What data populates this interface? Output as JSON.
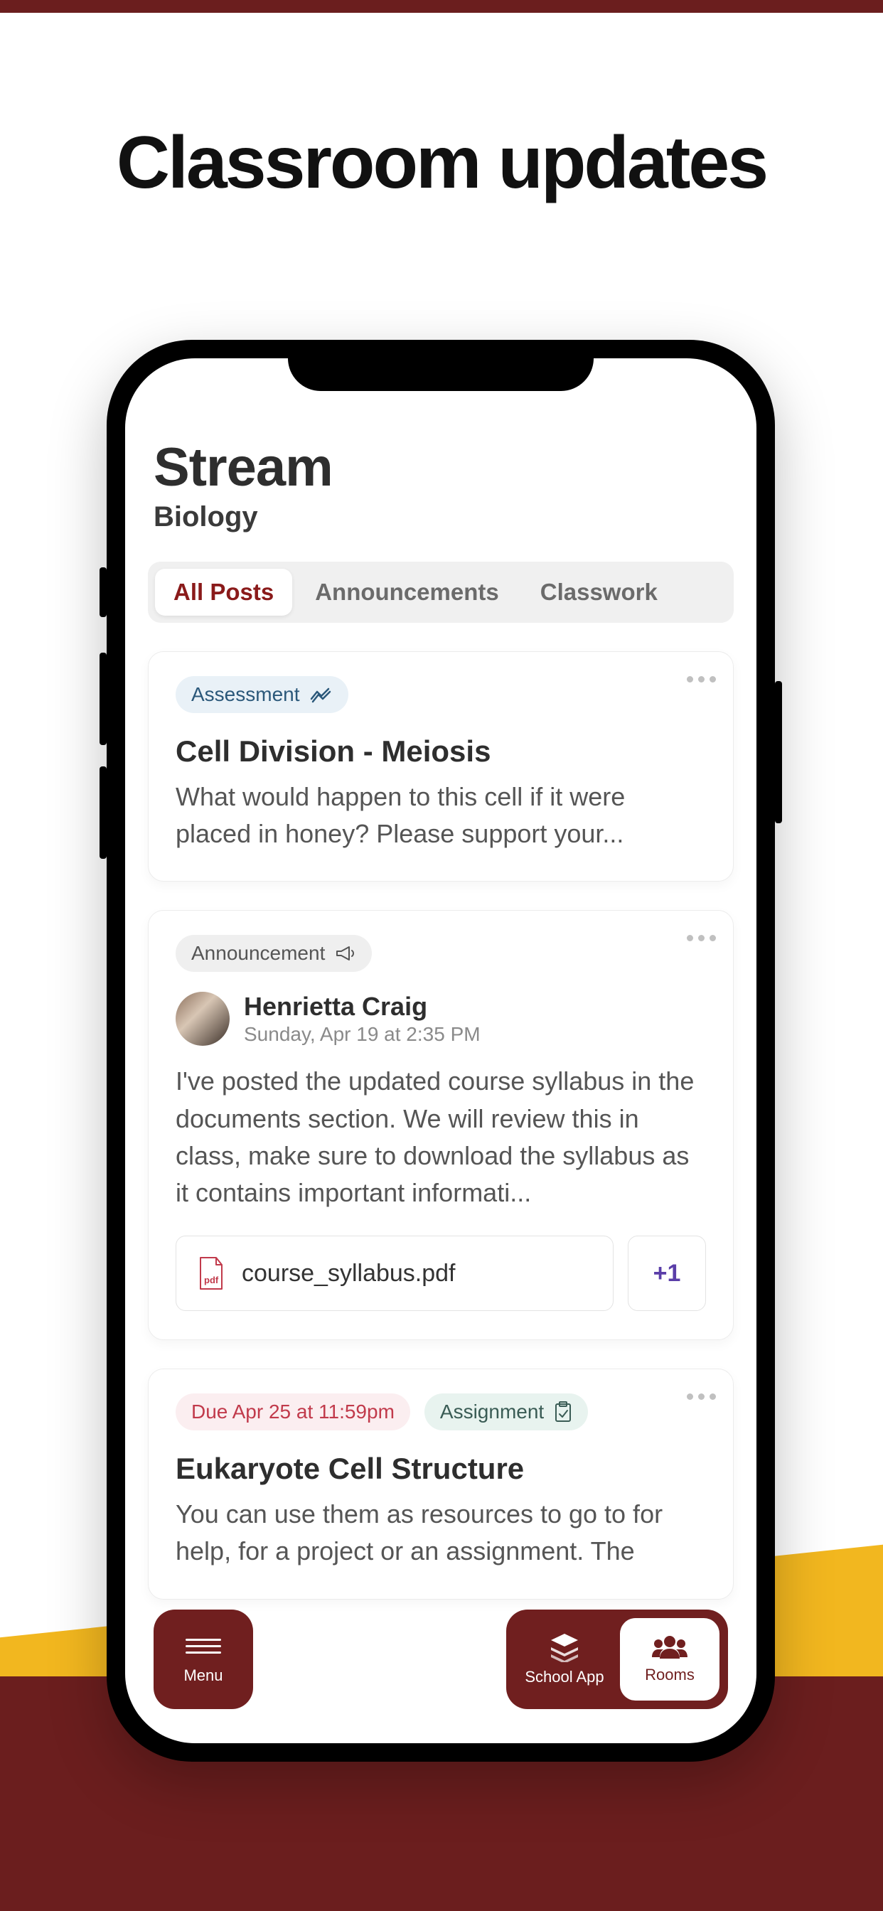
{
  "marketing": {
    "headline": "Classroom updates"
  },
  "header": {
    "title": "Stream",
    "subject": "Biology"
  },
  "tabs": [
    {
      "label": "All Posts",
      "active": true
    },
    {
      "label": "Announcements",
      "active": false
    },
    {
      "label": "Classwork",
      "active": false
    }
  ],
  "posts": [
    {
      "tag": {
        "label": "Assessment",
        "style": "blue",
        "icon": "chart-line-icon"
      },
      "title": "Cell Division - Meiosis",
      "body": "What would happen to this cell if it were placed in honey? Please support your..."
    },
    {
      "tag": {
        "label": "Announcement",
        "style": "grey",
        "icon": "megaphone-icon"
      },
      "author": {
        "name": "Henrietta Craig",
        "time": "Sunday, Apr 19 at 2:35 PM"
      },
      "body": "I've posted the updated course syllabus in the documents section. We will review this in class, make sure to download the syllabus as it contains important informati...",
      "attachment": {
        "filename": "course_syllabus.pdf",
        "icon": "pdf-icon"
      },
      "more_label": "+1"
    },
    {
      "due": {
        "label": "Due Apr 25 at 11:59pm"
      },
      "tag": {
        "label": "Assignment",
        "style": "green",
        "icon": "clipboard-check-icon"
      },
      "title": "Eukaryote Cell Structure",
      "body": "You can use them as resources to go to for help, for a project or an assignment. The"
    }
  ],
  "bottom": {
    "menu": {
      "label": "Menu"
    },
    "switcher": [
      {
        "label": "School App",
        "icon": "stack-icon",
        "active": false
      },
      {
        "label": "Rooms",
        "icon": "people-icon",
        "active": true
      }
    ]
  },
  "colors": {
    "maroon": "#6b1e1e",
    "yellow": "#f2b71f",
    "accent_red": "#8a1a1a"
  }
}
